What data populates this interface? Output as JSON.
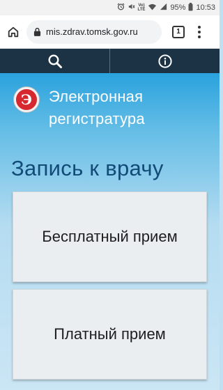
{
  "status_bar": {
    "volte_top": "Vo)",
    "volte_mid": "LTE",
    "battery": "95%",
    "time": "10:53"
  },
  "browser": {
    "url": "mis.zdrav.tomsk.gov.ru",
    "tab_count": "1"
  },
  "site": {
    "logo_letter": "Э",
    "brand_line1": "Электронная",
    "brand_line2": "регистратура",
    "page_title": "Запись к врачу",
    "buttons": [
      {
        "label": "Бесплатный прием"
      },
      {
        "label": "Платный прием"
      }
    ]
  },
  "colors": {
    "toolbar": "#1c3245",
    "title": "#124a78",
    "logo": "#d7272f"
  },
  "icons": {
    "toolbar_left": "search-icon",
    "toolbar_right": "info-icon"
  }
}
